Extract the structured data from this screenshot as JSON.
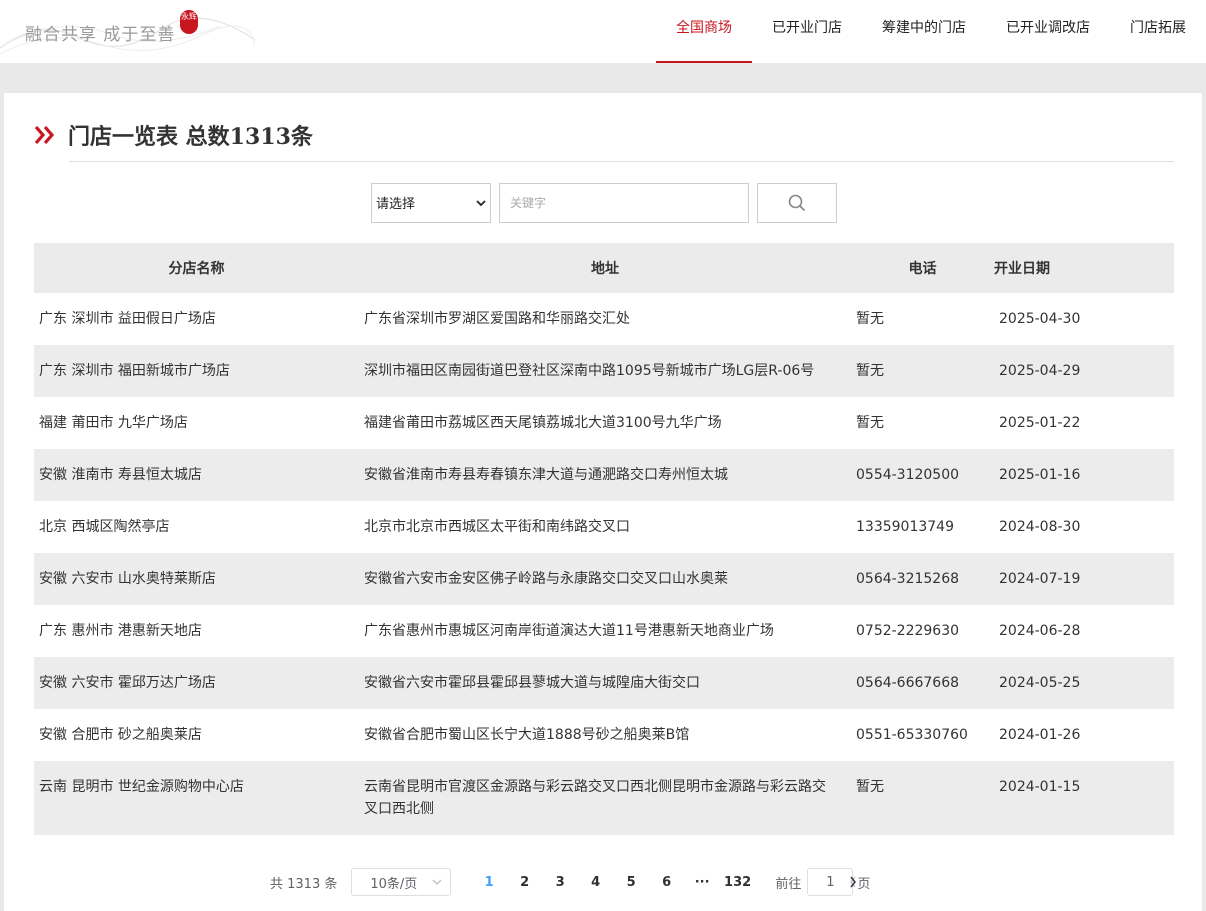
{
  "header": {
    "logo_text": "融合共享 成于至善",
    "logo_seal": "永辉",
    "nav": [
      {
        "label": "全国商场",
        "active": true
      },
      {
        "label": "已开业门店",
        "active": false
      },
      {
        "label": "筹建中的门店",
        "active": false
      },
      {
        "label": "已开业调改店",
        "active": false
      },
      {
        "label": "门店拓展",
        "active": false
      }
    ]
  },
  "main": {
    "title": "门店一览表 总数1313条",
    "search": {
      "select_value": "请选择",
      "keyword_placeholder": "关键字",
      "button_icon": "search-icon"
    },
    "table": {
      "headers": [
        "分店名称",
        "地址",
        "电话",
        "开业日期"
      ],
      "rows": [
        {
          "name": "广东 深圳市 益田假日广场店",
          "address": "广东省深圳市罗湖区爱国路和华丽路交汇处",
          "phone": "暂无",
          "date": "2025-04-30"
        },
        {
          "name": "广东 深圳市 福田新城市广场店",
          "address": "深圳市福田区南园街道巴登社区深南中路1095号新城市广场LG层R-06号",
          "phone": "暂无",
          "date": "2025-04-29"
        },
        {
          "name": "福建 莆田市 九华广场店",
          "address": "福建省莆田市荔城区西天尾镇荔城北大道3100号九华广场",
          "phone": "暂无",
          "date": "2025-01-22"
        },
        {
          "name": "安徽 淮南市 寿县恒太城店",
          "address": "安徽省淮南市寿县寿春镇东津大道与通淝路交口寿州恒太城",
          "phone": "0554-3120500",
          "date": "2025-01-16"
        },
        {
          "name": "北京 西城区陶然亭店",
          "address": "北京市北京市西城区太平街和南纬路交叉口",
          "phone": "13359013749",
          "date": "2024-08-30"
        },
        {
          "name": "安徽 六安市 山水奥特莱斯店",
          "address": "安徽省六安市金安区佛子岭路与永康路交口交叉口山水奥莱",
          "phone": "0564-3215268",
          "date": "2024-07-19"
        },
        {
          "name": "广东 惠州市 港惠新天地店",
          "address": "广东省惠州市惠城区河南岸街道演达大道11号港惠新天地商业广场",
          "phone": "0752-2229630",
          "date": "2024-06-28"
        },
        {
          "name": "安徽 六安市 霍邱万达广场店",
          "address": "安徽省六安市霍邱县霍邱县蓼城大道与城隍庙大街交口",
          "phone": "0564-6667668",
          "date": "2024-05-25"
        },
        {
          "name": "安徽 合肥市 砂之船奥莱店",
          "address": "安徽省合肥市蜀山区长宁大道1888号砂之船奥莱B馆",
          "phone": "0551-65330760",
          "date": "2024-01-26"
        },
        {
          "name": "云南 昆明市 世纪金源购物中心店",
          "address": "云南省昆明市官渡区金源路与彩云路交叉口西北侧昆明市金源路与彩云路交叉口西北侧",
          "phone": "暂无",
          "date": "2024-01-15"
        }
      ]
    },
    "pagination": {
      "total_text": "共 1313 条",
      "page_size": "10条/页",
      "pages": [
        "1",
        "2",
        "3",
        "4",
        "5",
        "6",
        "···",
        "132"
      ],
      "current_page": "1",
      "goto_label": "前往",
      "goto_value": "1",
      "page_suffix": "页"
    }
  },
  "colors": {
    "accent": "#c8161e",
    "pager_active": "#409eff"
  }
}
